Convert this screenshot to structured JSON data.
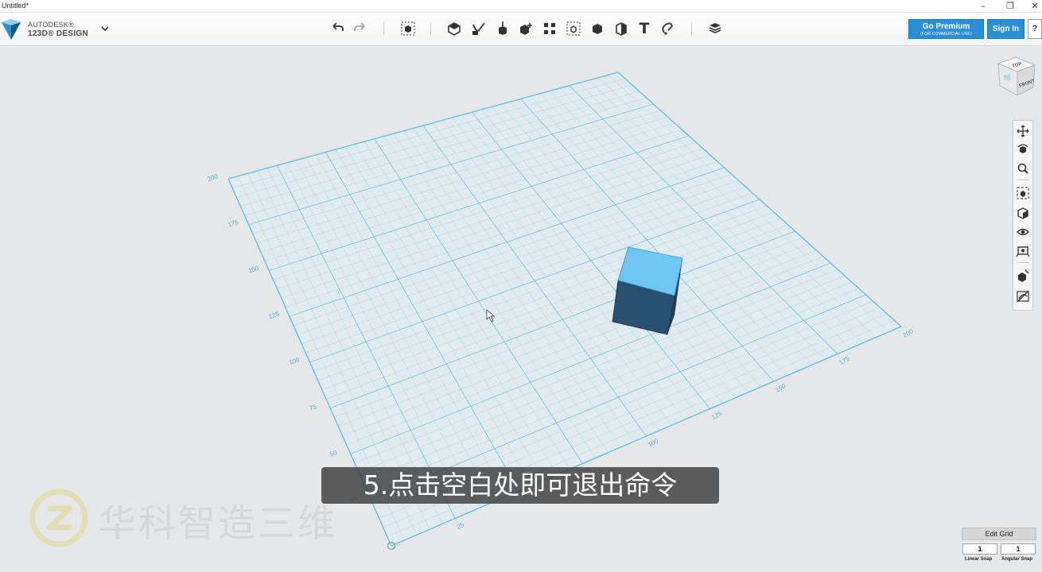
{
  "window": {
    "title": "Untitled*",
    "minimize_glyph": "–",
    "restore_glyph": "❐",
    "close_glyph": "✕"
  },
  "brand": {
    "line1": "AUTODESK®",
    "line2": "123D® DESIGN",
    "logo_icon": "123d-logo-icon",
    "dropdown_icon": "chevron-down-icon"
  },
  "toolbar": {
    "undo_icon": "undo-icon",
    "redo_icon": "redo-icon",
    "tools": [
      "transform-icon",
      "primitives-icon",
      "sketch-icon",
      "construct-icon",
      "modify-icon",
      "pattern-icon",
      "grouping-icon",
      "combine-icon",
      "measure-icon",
      "text-icon",
      "snap-icon",
      "material-icon"
    ],
    "text_tool_glyph": "T",
    "premium_label": "Go Premium",
    "premium_sublabel": "(FOR COMMERCIAL USE)",
    "signin_label": "Sign In",
    "help_label": "?"
  },
  "viewcube": {
    "top_label": "TOP",
    "front_label": "FRONT"
  },
  "nav_tools": [
    "pan-icon",
    "orbit-icon",
    "zoom-icon",
    "fit-icon",
    "view-cube-icon",
    "visibility-icon",
    "materials-outline-icon",
    "show-solids-icon",
    "hide-sketches-icon"
  ],
  "grid": {
    "left_axis_labels": [
      "200",
      "175",
      "150",
      "125",
      "100",
      "75",
      "50",
      "25"
    ],
    "bottom_axis_labels": [
      "25",
      "50",
      "75",
      "100",
      "125",
      "150",
      "175",
      "200"
    ],
    "line_color": "#62c0e3",
    "box_top_color": "#6ec7f2",
    "box_front_color": "#2a5070"
  },
  "edit_grid": {
    "title": "Edit Grid",
    "linear_snap_value": "1",
    "angular_snap_value": "1",
    "linear_snap_label": "Linear Snap",
    "angular_snap_label": "Angular Snap"
  },
  "subtitle": "5.点击空白处即可退出命令",
  "watermark_text": "华科智造三维",
  "accent_color": "#2b8fd6"
}
